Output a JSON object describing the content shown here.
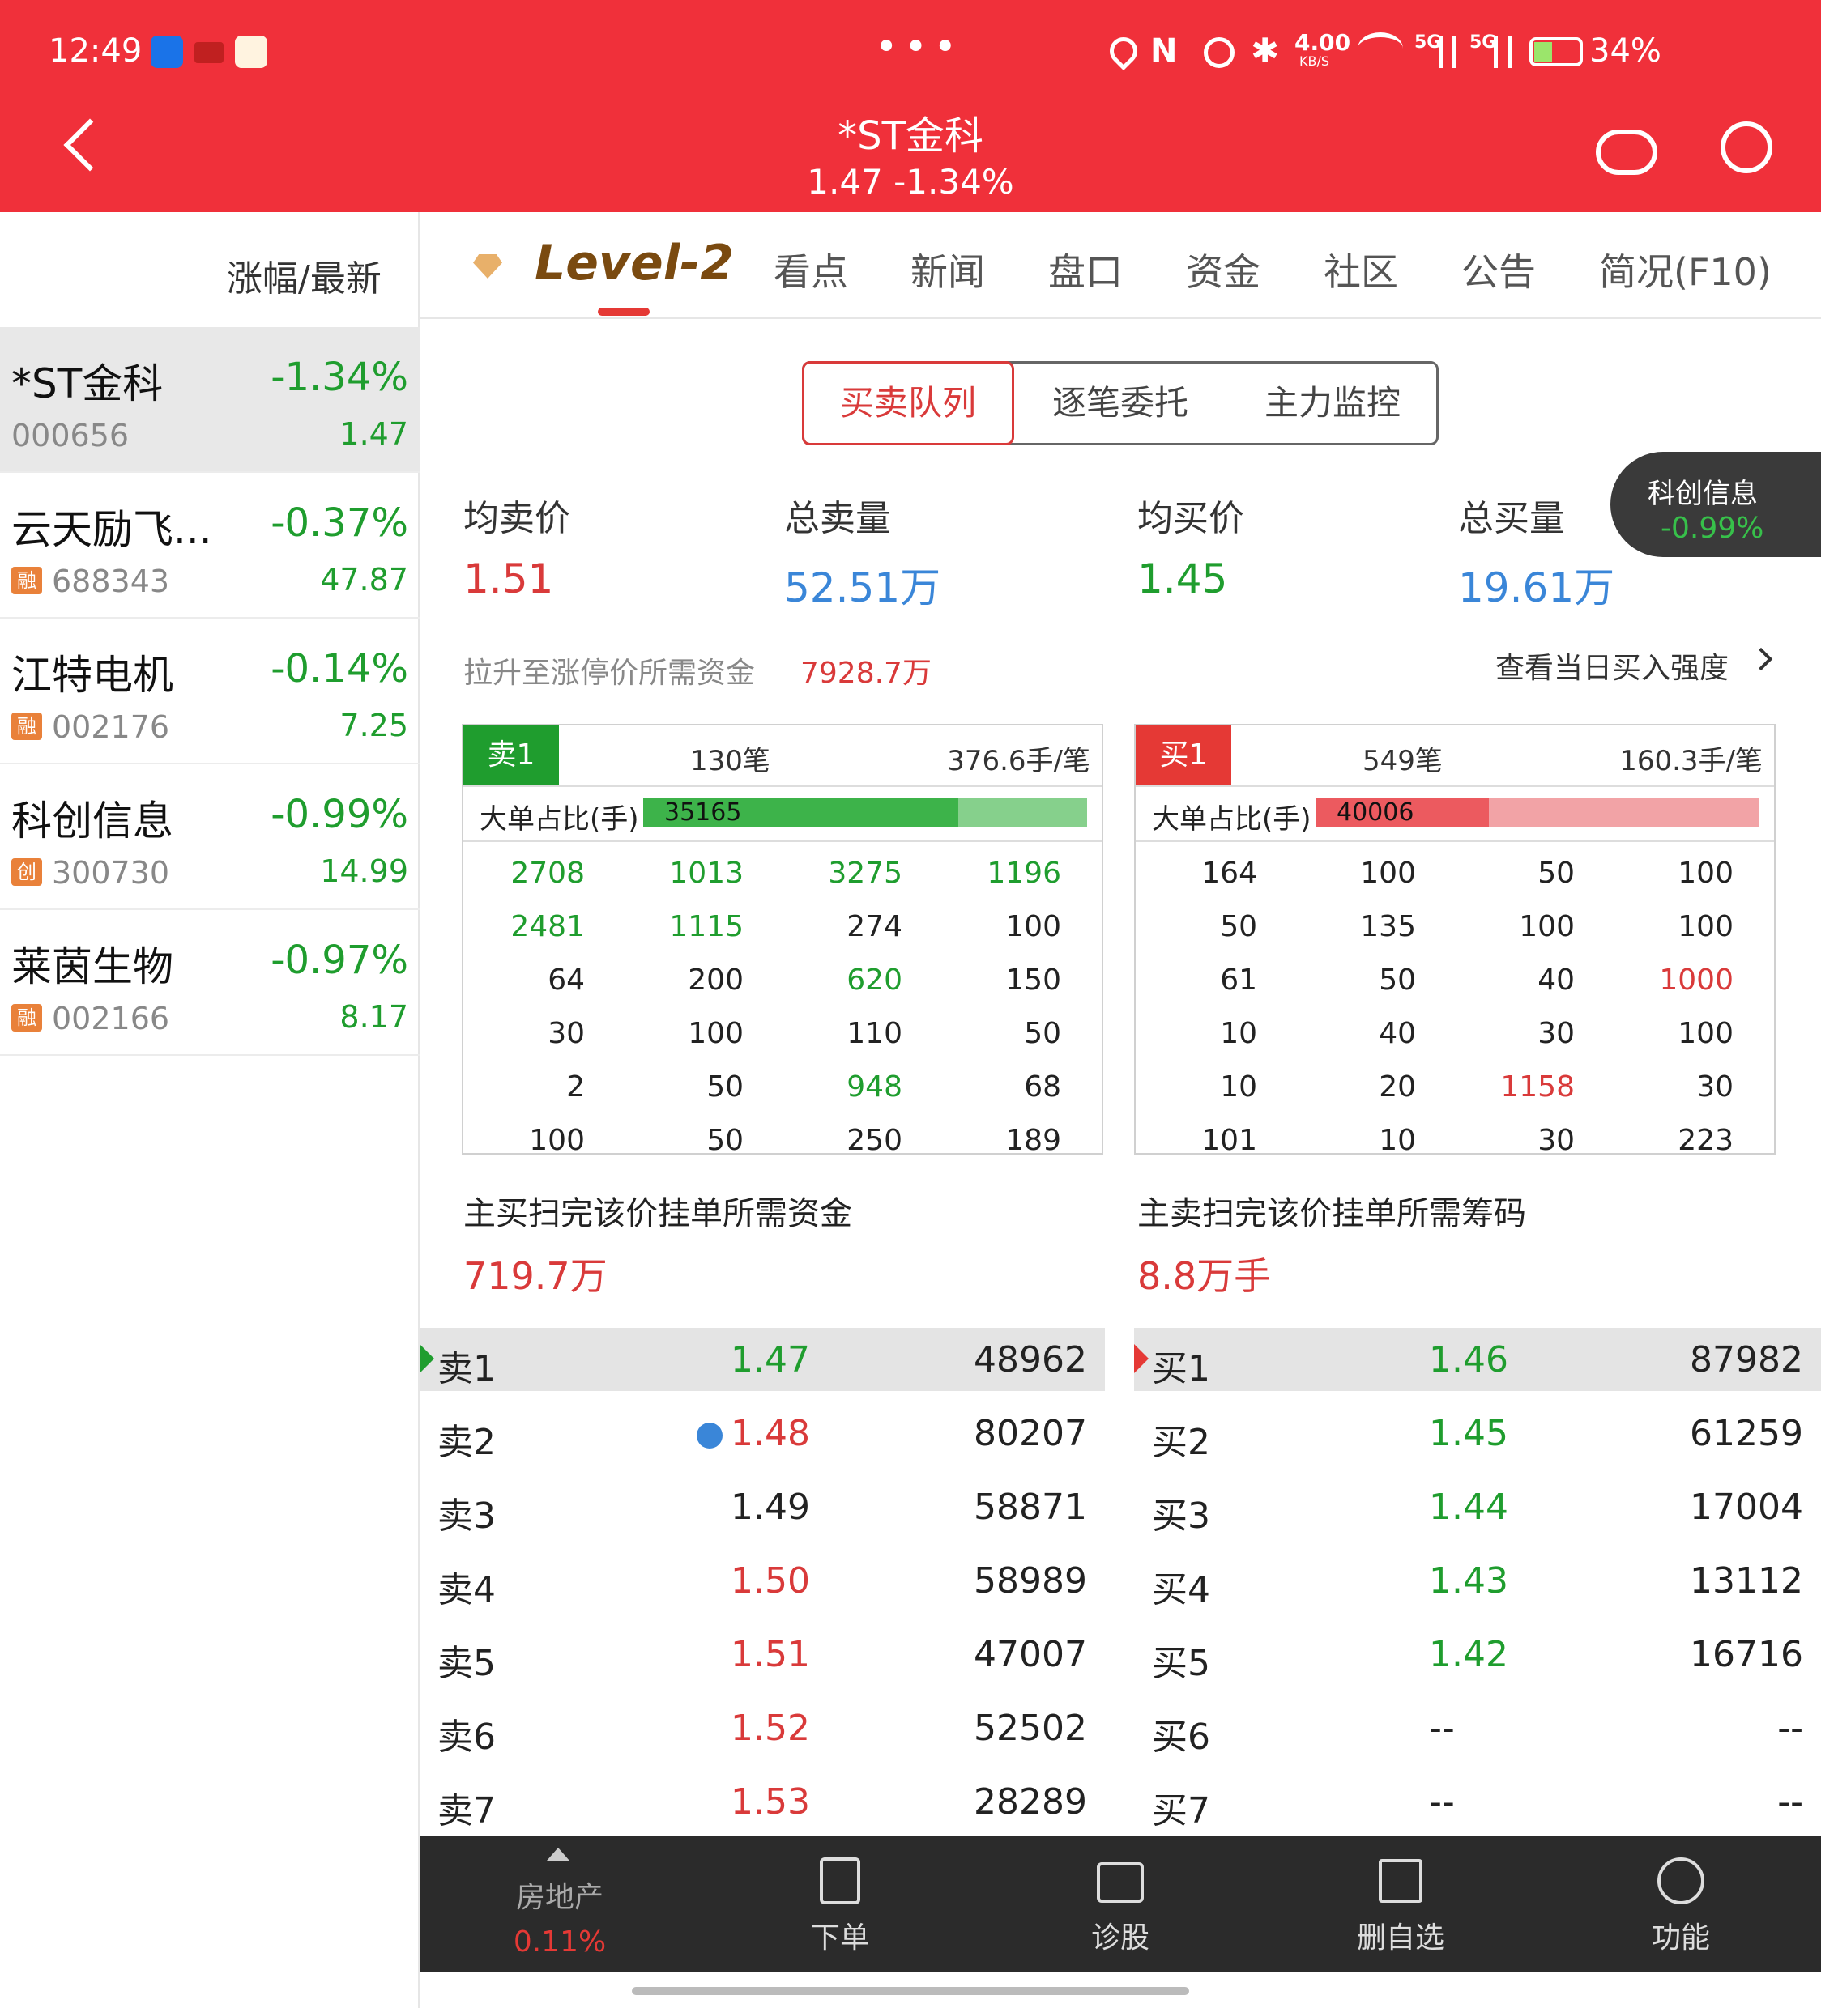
{
  "status": {
    "time": "12:49",
    "net": "4.00",
    "netunit": "KB/S",
    "battery": "34%",
    "sig1": "5G",
    "sig2": "5G",
    "dots": "•••"
  },
  "header": {
    "title": "*ST金科",
    "subtitle": "1.47 -1.34%"
  },
  "left": {
    "sort_label": "涨幅/最新",
    "items": [
      {
        "name": "*ST金科",
        "pct": "-1.34%",
        "code": "000656",
        "price": "1.47",
        "badge": ""
      },
      {
        "name": "云天励飞...",
        "pct": "-0.37%",
        "code": "688343",
        "price": "47.87",
        "badge": "融"
      },
      {
        "name": "江特电机",
        "pct": "-0.14%",
        "code": "002176",
        "price": "7.25",
        "badge": "融"
      },
      {
        "name": "科创信息",
        "pct": "-0.99%",
        "code": "300730",
        "price": "14.99",
        "badge": "创"
      },
      {
        "name": "莱茵生物",
        "pct": "-0.97%",
        "code": "002166",
        "price": "8.17",
        "badge": "融"
      }
    ]
  },
  "tabs": [
    "Level-2",
    "看点",
    "新闻",
    "盘口",
    "资金",
    "社区",
    "公告",
    "简况(F10)"
  ],
  "segments": [
    "买卖队列",
    "逐笔委托",
    "主力监控"
  ],
  "summary": {
    "avg_sell_label": "均卖价",
    "avg_sell": "1.51",
    "total_sell_label": "总卖量",
    "total_sell": "52.51万",
    "avg_buy_label": "均买价",
    "avg_buy": "1.45",
    "total_buy_label": "总买量",
    "total_buy": "19.61万"
  },
  "float_tip": {
    "name": "科创信息",
    "pct": "-0.99%"
  },
  "limit": {
    "label": "拉升至涨停价所需资金",
    "value": "7928.7万",
    "link": "查看当日买入强度"
  },
  "sell_queue": {
    "tag": "卖1",
    "count": "130笔",
    "avg": "376.6手/笔",
    "big_label": "大单占比(手)",
    "big_value": "35165",
    "big_ratio": 0.71,
    "rows": [
      [
        "2708",
        "1013",
        "3275",
        "1196"
      ],
      [
        "2481",
        "1115",
        "274",
        "100"
      ],
      [
        "64",
        "200",
        "620",
        "150"
      ],
      [
        "30",
        "100",
        "110",
        "50"
      ],
      [
        "2",
        "50",
        "948",
        "68"
      ],
      [
        "100",
        "50",
        "250",
        "189"
      ]
    ],
    "colors": [
      [
        "g",
        "g",
        "g",
        "g"
      ],
      [
        "g",
        "g",
        "k",
        "k"
      ],
      [
        "k",
        "k",
        "g",
        "k"
      ],
      [
        "k",
        "k",
        "k",
        "k"
      ],
      [
        "k",
        "k",
        "g",
        "k"
      ],
      [
        "k",
        "k",
        "k",
        "k"
      ]
    ],
    "foot_label": "主买扫完该价挂单所需资金",
    "foot_value": "719.7万"
  },
  "buy_queue": {
    "tag": "买1",
    "count": "549笔",
    "avg": "160.3手/笔",
    "big_label": "大单占比(手)",
    "big_value": "40006",
    "big_ratio": 0.39,
    "rows": [
      [
        "164",
        "100",
        "50",
        "100"
      ],
      [
        "50",
        "135",
        "100",
        "100"
      ],
      [
        "61",
        "50",
        "40",
        "1000"
      ],
      [
        "10",
        "40",
        "30",
        "100"
      ],
      [
        "10",
        "20",
        "1158",
        "30"
      ],
      [
        "101",
        "10",
        "30",
        "223"
      ]
    ],
    "colors": [
      [
        "k",
        "k",
        "k",
        "k"
      ],
      [
        "k",
        "k",
        "k",
        "k"
      ],
      [
        "k",
        "k",
        "k",
        "r"
      ],
      [
        "k",
        "k",
        "k",
        "k"
      ],
      [
        "k",
        "k",
        "r",
        "k"
      ],
      [
        "k",
        "k",
        "k",
        "k"
      ]
    ],
    "foot_label": "主卖扫完该价挂单所需筹码",
    "foot_value": "8.8万手"
  },
  "asks": [
    {
      "l": "卖1",
      "p": "1.47",
      "v": "48962",
      "c": "g"
    },
    {
      "l": "卖2",
      "p": "1.48",
      "v": "80207",
      "c": "r"
    },
    {
      "l": "卖3",
      "p": "1.49",
      "v": "58871",
      "c": "k"
    },
    {
      "l": "卖4",
      "p": "1.50",
      "v": "58989",
      "c": "r"
    },
    {
      "l": "卖5",
      "p": "1.51",
      "v": "47007",
      "c": "r"
    },
    {
      "l": "卖6",
      "p": "1.52",
      "v": "52502",
      "c": "r"
    },
    {
      "l": "卖7",
      "p": "1.53",
      "v": "28289",
      "c": "r"
    }
  ],
  "bids": [
    {
      "l": "买1",
      "p": "1.46",
      "v": "87982",
      "c": "g"
    },
    {
      "l": "买2",
      "p": "1.45",
      "v": "61259",
      "c": "g"
    },
    {
      "l": "买3",
      "p": "1.44",
      "v": "17004",
      "c": "g"
    },
    {
      "l": "买4",
      "p": "1.43",
      "v": "13112",
      "c": "g"
    },
    {
      "l": "买5",
      "p": "1.42",
      "v": "16716",
      "c": "g"
    },
    {
      "l": "买6",
      "p": "--",
      "v": "--",
      "c": "k"
    },
    {
      "l": "买7",
      "p": "--",
      "v": "--",
      "c": "k"
    }
  ],
  "footer": {
    "sector": "房地产",
    "sector_pct": "0.11%",
    "items": [
      "下单",
      "诊股",
      "删自选",
      "功能"
    ]
  },
  "colors": {
    "brand": "#f0303a",
    "up": "#d93a3a",
    "down": "#1f9d2e",
    "blue": "#3a86d8"
  }
}
